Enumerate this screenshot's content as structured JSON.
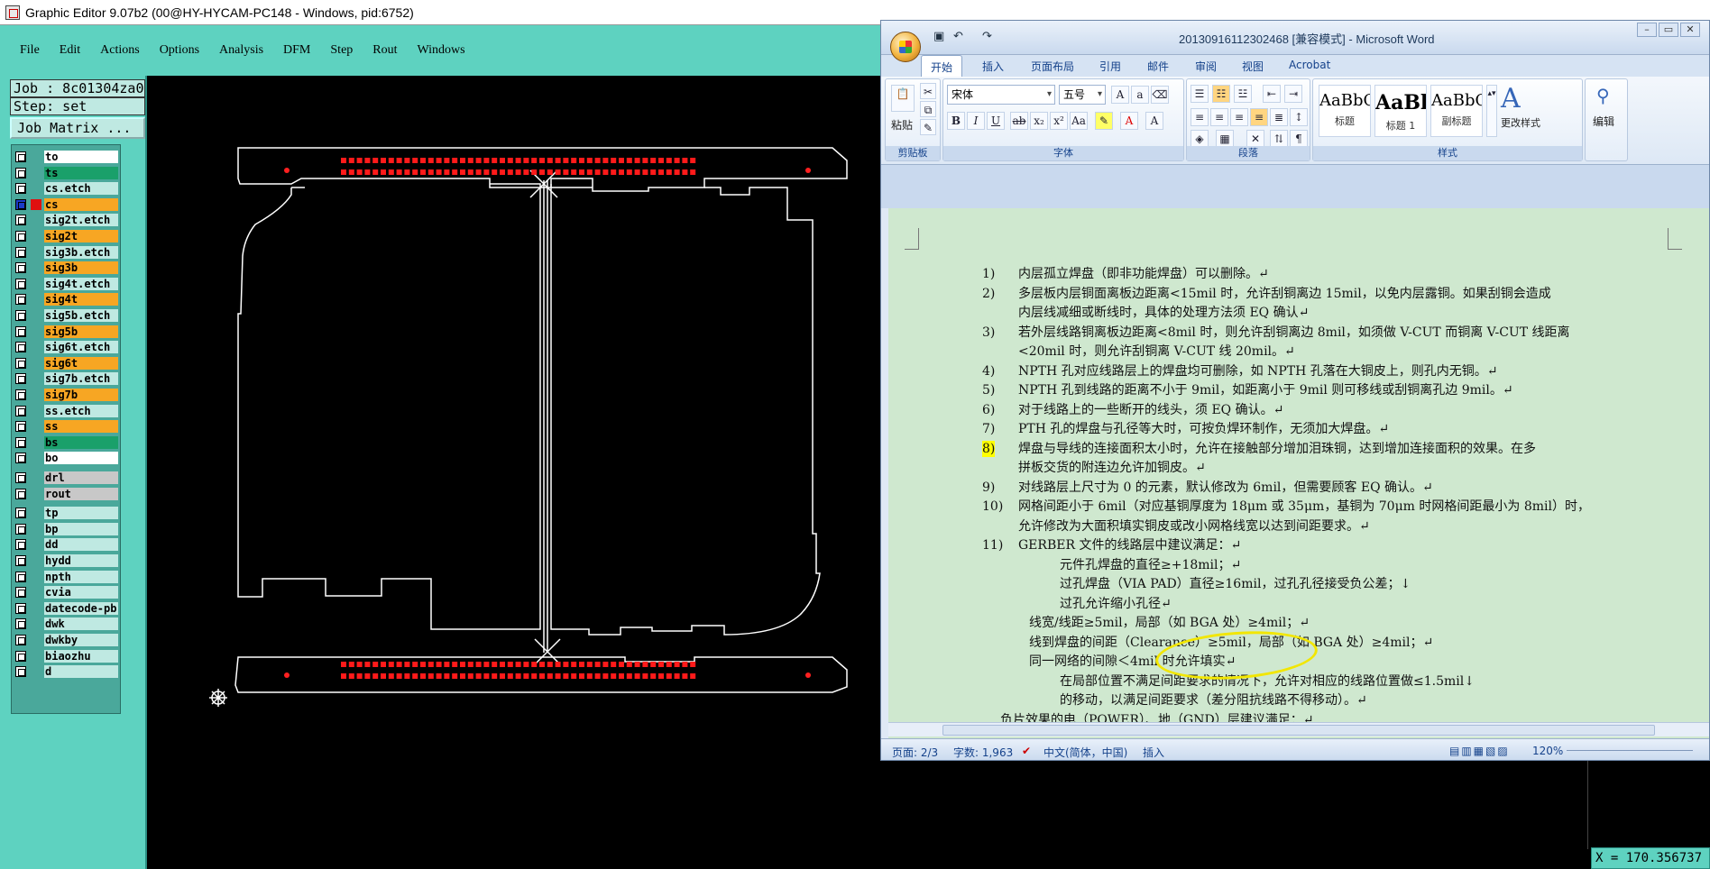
{
  "editor": {
    "title": "Graphic Editor 9.07b2 (00@HY-HYCAM-PC148 - Windows, pid:6752)",
    "menu": [
      "File",
      "Edit",
      "Actions",
      "Options",
      "Analysis",
      "DFM",
      "Step",
      "Rout",
      "Windows"
    ],
    "job_label": "Job : 8c01304za0",
    "step_label": "Step: set",
    "job_matrix": "Job Matrix ...",
    "coord": "X = 170.356737",
    "layers": [
      {
        "name": "to",
        "color": "#ffffff"
      },
      {
        "name": "ts",
        "color": "#1aa06a"
      },
      {
        "name": "cs.etch",
        "color": "#bfe9e2"
      },
      {
        "name": "cs",
        "color": "#f7a623",
        "active": true
      },
      {
        "name": "sig2t.etch",
        "color": "#bfe9e2"
      },
      {
        "name": "sig2t",
        "color": "#f7a623"
      },
      {
        "name": "sig3b.etch",
        "color": "#bfe9e2"
      },
      {
        "name": "sig3b",
        "color": "#f7a623"
      },
      {
        "name": "sig4t.etch",
        "color": "#bfe9e2"
      },
      {
        "name": "sig4t",
        "color": "#f7a623"
      },
      {
        "name": "sig5b.etch",
        "color": "#bfe9e2"
      },
      {
        "name": "sig5b",
        "color": "#f7a623"
      },
      {
        "name": "sig6t.etch",
        "color": "#bfe9e2"
      },
      {
        "name": "sig6t",
        "color": "#f7a623"
      },
      {
        "name": "sig7b.etch",
        "color": "#bfe9e2"
      },
      {
        "name": "sig7b",
        "color": "#f7a623"
      },
      {
        "name": "ss.etch",
        "color": "#bfe9e2"
      },
      {
        "name": "ss",
        "color": "#f7a623"
      },
      {
        "name": "bs",
        "color": "#1aa06a"
      },
      {
        "name": "bo",
        "color": "#ffffff"
      },
      {
        "name": "drl",
        "color": "#c8c8c8"
      },
      {
        "name": "rout",
        "color": "#c8c8c8"
      },
      {
        "name": "tp",
        "color": "#bfe9e2"
      },
      {
        "name": "bp",
        "color": "#bfe9e2"
      },
      {
        "name": "dd",
        "color": "#bfe9e2"
      },
      {
        "name": "hydd",
        "color": "#bfe9e2"
      },
      {
        "name": "npth",
        "color": "#bfe9e2"
      },
      {
        "name": "cvia",
        "color": "#bfe9e2"
      },
      {
        "name": "datecode-pb",
        "color": "#bfe9e2"
      },
      {
        "name": "dwk",
        "color": "#bfe9e2"
      },
      {
        "name": "dwkby",
        "color": "#bfe9e2"
      },
      {
        "name": "biaozhu",
        "color": "#bfe9e2"
      },
      {
        "name": "d",
        "color": "#bfe9e2"
      }
    ]
  },
  "word": {
    "title": "20130916112302468 [兼容模式] - Microsoft Word",
    "tabs": [
      "开始",
      "插入",
      "页面布局",
      "引用",
      "邮件",
      "审阅",
      "视图",
      "Acrobat"
    ],
    "ribbon": {
      "paste": "粘贴",
      "clipboard": "剪贴板",
      "font_name": "宋体",
      "font_size": "五号",
      "font_group": "字体",
      "paragraph_group": "段落",
      "styles_group": "样式",
      "styles": [
        {
          "preview": "AaBbC",
          "name": "标题"
        },
        {
          "preview": "AaBl",
          "name": "标题 1"
        },
        {
          "preview": "AaBbC",
          "name": "副标题"
        }
      ],
      "change_styles": "更改样式",
      "edit": "编辑"
    },
    "items": [
      {
        "n": "1)",
        "lines": [
          "内层孤立焊盘（即非功能焊盘）可以删除。↵"
        ]
      },
      {
        "n": "2)",
        "lines": [
          "多层板内层铜面离板边距离<15mil 时，允许刮铜离边 15mil，以免内层露铜。如果刮铜会造成",
          "内层线减细或断线时，具体的处理方法须 EQ 确认↵"
        ]
      },
      {
        "n": "3)",
        "lines": [
          "若外层线路铜离板边距离<8mil 时，则允许刮铜离边 8mil，如须做 V-CUT 而铜离 V-CUT 线距离",
          "<20mil 时，则允许刮铜离 V-CUT 线 20mil。↵"
        ]
      },
      {
        "n": "4)",
        "lines": [
          "NPTH 孔对应线路层上的焊盘均可删除，如 NPTH 孔落在大铜皮上，则孔内无铜。↵"
        ]
      },
      {
        "n": "5)",
        "lines": [
          "NPTH 孔到线路的距离不小于 9mil，如距离小于 9mil 则可移线或刮铜离孔边 9mil。↵"
        ]
      },
      {
        "n": "6)",
        "lines": [
          "对于线路上的一些断开的线头，须 EQ 确认。↵"
        ]
      },
      {
        "n": "7)",
        "lines": [
          "PTH 孔的焊盘与孔径等大时，可按负焊环制作，无须加大焊盘。↵"
        ]
      },
      {
        "n": "8)",
        "lines": [
          "焊盘与导线的连接面积太小时，允许在接触部分增加泪珠铜，达到增加连接面积的效果。在多",
          "拼板交货的附连边允许加铜皮。↵"
        ]
      },
      {
        "n": "9)",
        "lines": [
          "对线路层上尺寸为 0 的元素，默认修改为 6mil，但需要顾客 EQ 确认。↵"
        ]
      },
      {
        "n": "10)",
        "lines": [
          "网格间距小于 6mil（对应基铜厚度为 18μm 或 35μm，基铜为 70μm 时网格间距最小为 8mil）时，",
          "允许修改为大面积填实铜皮或改小网格线宽以达到间距要求。↵"
        ]
      },
      {
        "n": "11)",
        "lines": [
          "GERBER 文件的线路层中建议满足：↵"
        ]
      }
    ],
    "sub_lines": [
      {
        "indent": 2,
        "text": "元件孔焊盘的直径≥+18mil；↵"
      },
      {
        "indent": 2,
        "text": "过孔焊盘（VIA PAD）直径≥16mil，过孔孔径接受负公差；↓"
      },
      {
        "indent": 2,
        "text": "过孔允许缩小孔径↵"
      },
      {
        "indent": 1,
        "text": "线宽/线距≥5mil，局部（如 BGA 处）≥4mil；↵"
      },
      {
        "indent": 1,
        "text": "线到焊盘的间距（Clearance）≥5mil，局部（如 BGA 处）≥4mil；↵"
      },
      {
        "indent": 1,
        "text": "同一网络的间隙＜4mil 时允许填实↵"
      },
      {
        "indent": 2,
        "text": "在局部位置不满足间距要求的情况下，允许对相应的线路位置做≤1.5mil↓"
      },
      {
        "indent": 2,
        "text": "的移动，以满足间距要求（差分阻抗线路不得移动）。↵"
      },
      {
        "indent": 0,
        "text": "负片效果的电（POWER）、地（GND）层建议满足：↵"
      }
    ],
    "status": {
      "page": "页面: 2/3",
      "words": "字数: 1,963",
      "lang": "中文(简体，中国)",
      "mode": "插入",
      "zoom": "120%"
    }
  }
}
